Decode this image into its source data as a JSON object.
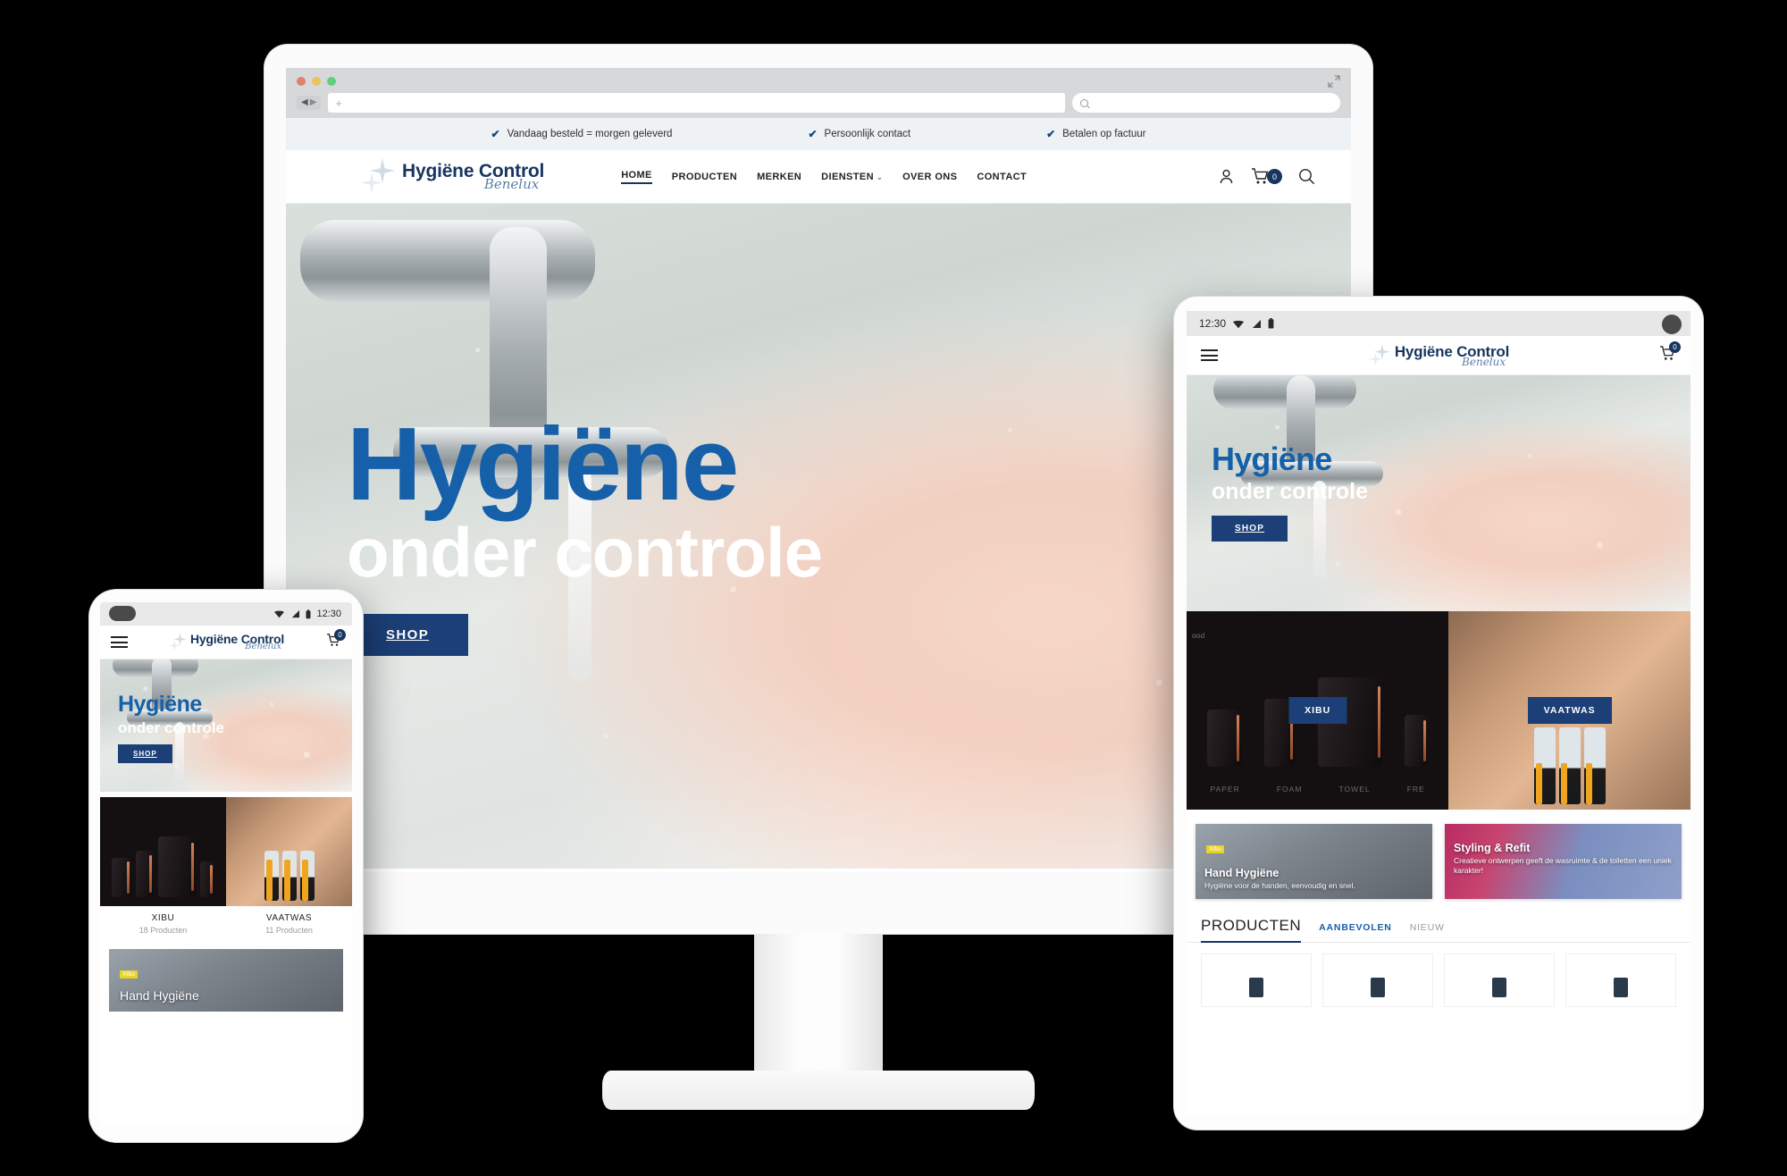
{
  "browser": {
    "traffic_lights": [
      "close",
      "minimize",
      "zoom"
    ],
    "url_placeholder": "",
    "new_tab_glyph": "+",
    "search_placeholder": "",
    "back_glyph": "◀",
    "forward_glyph": "▶"
  },
  "usp_bar": {
    "check_glyph": "✔",
    "items": [
      "Vandaag besteld = morgen geleverd",
      "Persoonlijk contact",
      "Betalen op factuur"
    ]
  },
  "brand": {
    "name": "Hygiëne Control",
    "tagline": "Benelux",
    "color_dark": "#17355f",
    "color_accent": "#1560a8",
    "color_button": "#1b3f76"
  },
  "desktop_nav": {
    "items": [
      {
        "label": "HOME",
        "active": true,
        "has_caret": false
      },
      {
        "label": "PRODUCTEN",
        "active": false,
        "has_caret": false
      },
      {
        "label": "MERKEN",
        "active": false,
        "has_caret": false
      },
      {
        "label": "DIENSTEN",
        "active": false,
        "has_caret": true
      },
      {
        "label": "OVER ONS",
        "active": false,
        "has_caret": false
      },
      {
        "label": "CONTACT",
        "active": false,
        "has_caret": false
      }
    ],
    "caret_glyph": "⌄",
    "account_icon": "user-icon",
    "cart_icon": "cart-icon",
    "cart_count": "0",
    "search_icon": "search-icon"
  },
  "hero": {
    "line1": "Hygiëne",
    "line2": "onder controle",
    "button": "SHOP"
  },
  "mobile_status": {
    "time": "12:30",
    "wifi_icon": "wifi-icon",
    "signal_icon": "signal-icon",
    "battery_icon": "battery-icon"
  },
  "mobile_header": {
    "menu_icon": "hamburger-icon",
    "cart_icon": "cart-icon",
    "cart_count": "0"
  },
  "categories": [
    {
      "pill": "XIBU",
      "name": "XIBU",
      "count": "18 Producten"
    },
    {
      "pill": "VAATWAS",
      "name": "VAATWAS",
      "count": "11 Producten"
    }
  ],
  "xibu_tile": {
    "corner_label": "ood",
    "dispenser_labels": [
      "PAPER",
      "FOAM",
      "TOWEL",
      "FRE"
    ]
  },
  "promos": [
    {
      "title": "Hand Hygiëne",
      "subtitle": "Hygiëne voor de handen, eenvoudig en snel.",
      "tag": "Xibu"
    },
    {
      "title": "Styling & Refit",
      "subtitle": "Creatieve ontwerpen geeft de wasruimte & de toiletten een uniek karakter!"
    }
  ],
  "products_section": {
    "heading": "PRODUCTEN",
    "tabs": [
      {
        "label": "AANBEVOLEN",
        "selected": true
      },
      {
        "label": "NIEUW",
        "selected": false
      }
    ]
  }
}
